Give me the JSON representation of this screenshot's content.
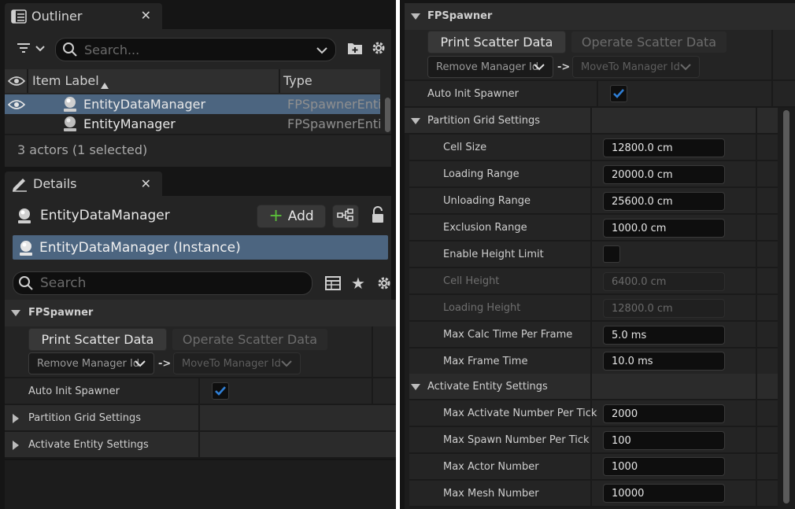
{
  "colors": {
    "selection": "#4c6580",
    "accent_blue": "#2f7fd6",
    "add_green": "#5bbf3a",
    "panel_bg": "#242424",
    "input_bg": "#0e0e0e"
  },
  "outliner": {
    "tab_title": "Outliner",
    "tab_icon": "outliner-list-icon",
    "search_placeholder": "Search...",
    "columns": {
      "label": "Item Label",
      "type": "Type"
    },
    "rows": [
      {
        "label": "EntityDataManager",
        "type": "FPSpawnerEntit",
        "selected": true
      },
      {
        "label": "EntityManager",
        "type": "FPSpawnerEntit",
        "selected": false
      }
    ],
    "status": "3 actors (1 selected)"
  },
  "details": {
    "tab_title": "Details",
    "tab_icon": "pencil-icon",
    "object_name": "EntityDataManager",
    "add_label": "Add",
    "instance_label": "EntityDataManager (Instance)",
    "search_placeholder": "Search",
    "fpspawner": {
      "title": "FPSpawner",
      "print_button": "Print Scatter Data",
      "operate_button": "Operate Scatter Data",
      "remove_combo": "Remove Manager Id",
      "arrow": "->",
      "moveto_combo": "MoveTo Manager Id",
      "auto_init_label": "Auto Init Spawner",
      "auto_init_checked": true
    },
    "partition_title": "Partition Grid Settings",
    "activate_title": "Activate Entity Settings"
  },
  "right_details": {
    "fpspawner": {
      "title": "FPSpawner",
      "print_button": "Print Scatter Data",
      "operate_button": "Operate Scatter Data",
      "remove_combo": "Remove Manager Id",
      "arrow": "->",
      "moveto_combo": "MoveTo Manager Id",
      "auto_init_label": "Auto Init Spawner",
      "auto_init_checked": true
    },
    "partition": {
      "title": "Partition Grid Settings",
      "props": [
        {
          "label": "Cell Size",
          "value": "12800.0 cm",
          "enabled": true
        },
        {
          "label": "Loading Range",
          "value": "20000.0 cm",
          "enabled": true
        },
        {
          "label": "Unloading Range",
          "value": "25600.0 cm",
          "enabled": true
        },
        {
          "label": "Exclusion Range",
          "value": "1000.0 cm",
          "enabled": true
        },
        {
          "label": "Enable Height Limit",
          "checkbox": true,
          "checked": false
        },
        {
          "label": "Cell Height",
          "value": "6400.0 cm",
          "enabled": false
        },
        {
          "label": "Loading Height",
          "value": "12800.0 cm",
          "enabled": false
        },
        {
          "label": "Max Calc Time Per Frame",
          "value": "5.0 ms",
          "enabled": true
        },
        {
          "label": "Max Frame Time",
          "value": "10.0 ms",
          "enabled": true
        }
      ]
    },
    "activate": {
      "title": "Activate Entity Settings",
      "props": [
        {
          "label": "Max Activate Number Per Tick",
          "value": "2000",
          "enabled": true
        },
        {
          "label": "Max Spawn Number Per Tick",
          "value": "100",
          "enabled": true
        },
        {
          "label": "Max Actor Number",
          "value": "1000",
          "enabled": true
        },
        {
          "label": "Max Mesh Number",
          "value": "10000",
          "enabled": true
        }
      ]
    }
  }
}
